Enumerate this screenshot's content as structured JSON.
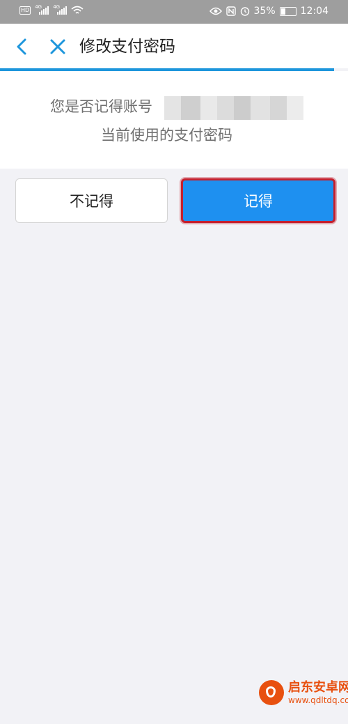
{
  "status_bar": {
    "hd": "HD",
    "network_1": "4G",
    "network_2": "4G",
    "battery": "35%",
    "time": "12:04"
  },
  "nav": {
    "title": "修改支付密码",
    "back_icon": "chevron-left-icon",
    "close_icon": "close-icon",
    "accent_color": "#1e96dc"
  },
  "prompt": {
    "line1": "您是否记得账号",
    "line2": "当前使用的支付密码"
  },
  "buttons": {
    "no_label": "不记得",
    "yes_label": "记得",
    "yes_color": "#1e90f0",
    "highlight_color": "#c4202e"
  },
  "watermark": {
    "name": "启东安卓网",
    "url": "www.qdltdq.com"
  }
}
